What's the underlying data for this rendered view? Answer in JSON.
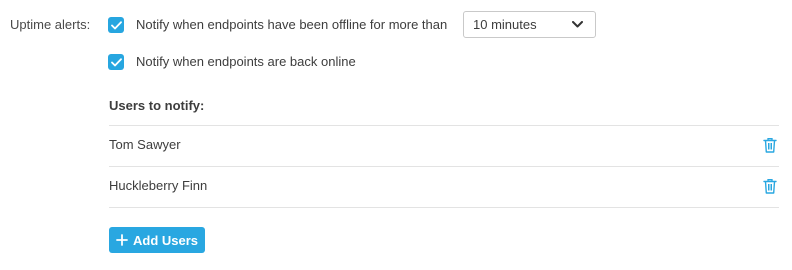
{
  "uptime": {
    "label": "Uptime alerts:",
    "offline_option": {
      "label": "Notify when endpoints have been offline for more than",
      "checked": true
    },
    "online_option": {
      "label": "Notify when endpoints are back online",
      "checked": true
    },
    "duration_select": {
      "value": "10 minutes"
    }
  },
  "users_section": {
    "title": "Users to notify:",
    "users": [
      {
        "name": "Tom Sawyer"
      },
      {
        "name": "Huckleberry Finn"
      }
    ],
    "add_button_label": "Add Users"
  },
  "icons": {
    "checkbox": "check-icon",
    "select": "chevron-down-icon",
    "delete": "trash-icon",
    "add": "plus-icon"
  },
  "colors": {
    "accent": "#29a7e1",
    "text": "#3d3d3d",
    "divider": "#e3e3e3"
  }
}
